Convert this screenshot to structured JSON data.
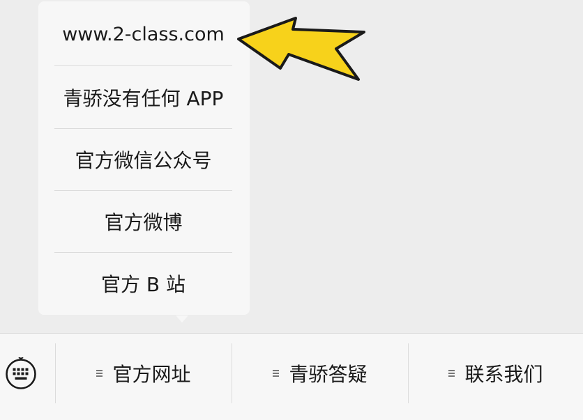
{
  "popup_menu": {
    "items": [
      {
        "label": "www.2-class.com"
      },
      {
        "label": "青骄没有任何 APP"
      },
      {
        "label": "官方微信公众号"
      },
      {
        "label": "官方微博"
      },
      {
        "label": "官方 B 站"
      }
    ]
  },
  "annotation": {
    "arrow_color": "#f7d21b",
    "arrow_outline": "#1a1a1a"
  },
  "bottom_bar": {
    "keyboard_icon": "keyboard-icon",
    "menus": [
      {
        "label": "官方网址",
        "icon": "menu-lines-icon"
      },
      {
        "label": "青骄答疑",
        "icon": "menu-lines-icon"
      },
      {
        "label": "联系我们",
        "icon": "menu-lines-icon"
      }
    ]
  }
}
